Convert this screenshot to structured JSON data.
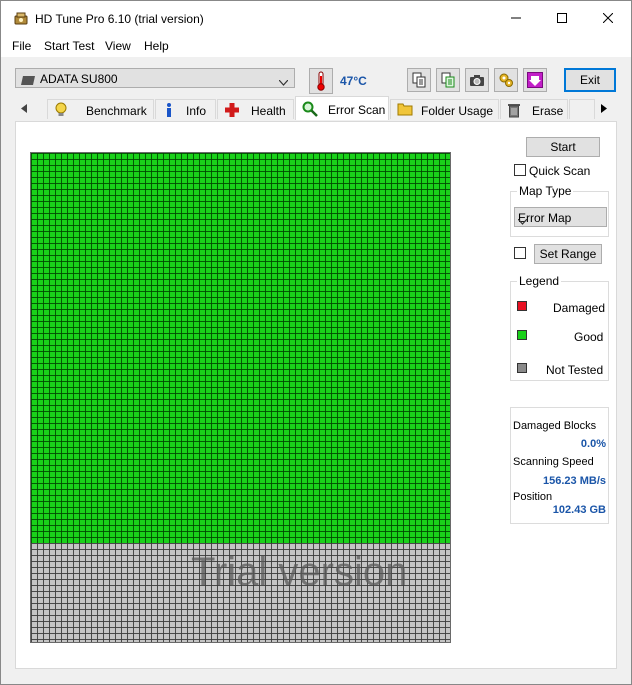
{
  "window": {
    "title": "HD Tune Pro 6.10 (trial version)",
    "controls": [
      "minimize",
      "maximize",
      "close"
    ]
  },
  "menu": [
    "File",
    "Start Test",
    "View",
    "Help"
  ],
  "toolbar": {
    "drive": "ADATA SU800",
    "temperature": "47°C",
    "icons": [
      "thermometer-icon",
      "copy-text-icon",
      "copy-info-icon",
      "screenshot-icon",
      "options-icon",
      "save-icon"
    ],
    "exit_label": "Exit"
  },
  "tabs": [
    {
      "label": "Benchmark",
      "icon": "benchmark-icon"
    },
    {
      "label": "Info",
      "icon": "info-icon"
    },
    {
      "label": "Health",
      "icon": "health-icon"
    },
    {
      "label": "Error Scan",
      "icon": "magnifier-icon",
      "active": true
    },
    {
      "label": "Folder Usage",
      "icon": "folder-icon"
    },
    {
      "label": "Erase",
      "icon": "trash-icon"
    }
  ],
  "scan": {
    "watermark": "Trial version",
    "scanned_fraction": 0.8,
    "colors": {
      "good": "#1ad11a",
      "damaged": "#e81123",
      "not_tested": "#c4c4c4"
    }
  },
  "controls": {
    "start_label": "Start",
    "quick_scan_label": "Quick Scan",
    "quick_scan_checked": false,
    "map_type_title": "Map Type",
    "map_type_value": "Error Map",
    "set_range_label": "Set Range",
    "set_range_checked": false
  },
  "legend": {
    "title": "Legend",
    "items": [
      {
        "label": "Damaged",
        "color": "#e81123"
      },
      {
        "label": "Good",
        "color": "#1ad11a"
      },
      {
        "label": "Not Tested",
        "color": "#8a8a8a"
      }
    ]
  },
  "stats": {
    "damaged_blocks_label": "Damaged Blocks",
    "damaged_blocks_value": "0.0%",
    "scanning_speed_label": "Scanning Speed",
    "scanning_speed_value": "156.23 MB/s",
    "position_label": "Position",
    "position_value": "102.43 GB"
  }
}
